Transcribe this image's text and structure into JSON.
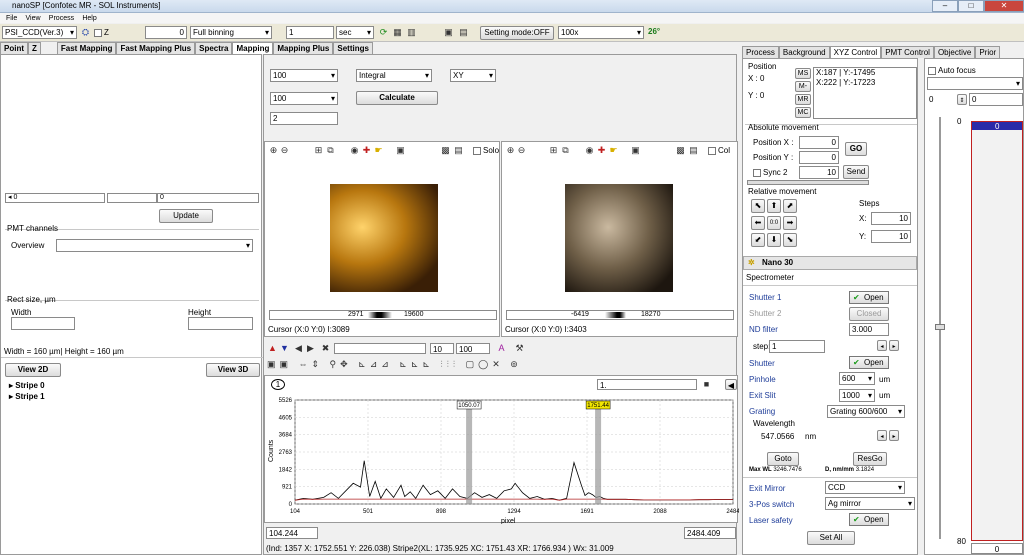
{
  "window": {
    "title": "nanoSP [Confotec MR - SOL Instruments]"
  },
  "menu": [
    "File",
    "View",
    "Process",
    "Help"
  ],
  "toolbar": {
    "device": "PSI_CCD(Ver.3)",
    "z_label": "Z",
    "value0": "0",
    "binning": "Full binning",
    "exposure": "1",
    "unit": "sec",
    "mode_button": "Setting mode:OFF",
    "objective": "100x",
    "temperature": "26°"
  },
  "left_tabs": [
    "Point",
    "Z",
    "Fast Mapping",
    "Fast Mapping Plus",
    "Spectra",
    "Mapping",
    "Mapping Plus",
    "Settings"
  ],
  "left": {
    "slider1_value": "0",
    "slider2_value": "0",
    "update_btn": "Update",
    "pmt_channels": "PMT channels",
    "overview": "Overview",
    "rect_size": "Rect size, µm",
    "width_lbl": "Width",
    "height_lbl": "Height",
    "size_text": "Width = 160 µm| Height = 160 µm",
    "view2d": "View 2D",
    "view3d": "View 3D",
    "tree": [
      "Stripe 0",
      "Stripe 1"
    ]
  },
  "center": {
    "c1": "100",
    "c2": "Integral",
    "c3": "XY",
    "c4": "100",
    "calculate": "Calculate",
    "f5": "2",
    "img1_solo": "Solo",
    "img2_col": "Col",
    "hist1_min": "2971",
    "hist1_max": "19600",
    "hist2_min": "-6419",
    "hist2_max": "18270",
    "cursor1": "Cursor (X:0 Y:0) I:3089",
    "cursor2": "Cursor (X:0 Y:0) I:3403",
    "spec_val1": "10",
    "spec_val2": "100",
    "circle_num": "1",
    "spec_field": "1.",
    "pos_left": "104.244",
    "pos_right": "2484.409",
    "status": "(Ind: 1357 X: 1752.551 Y: 226.038)  Stripe2(XL: 1735.925 XC: 1751.43 XR: 1766.934 )  Wx: 31.009"
  },
  "chart_data": {
    "type": "line",
    "ylabel": "Counts",
    "xlabel": "pixel",
    "yticks": [
      "5526",
      "4605",
      "3684",
      "2763",
      "1842",
      "921",
      "0"
    ],
    "xticks": [
      "104",
      "501",
      "898",
      "1294",
      "1691",
      "2088",
      "2484"
    ],
    "ylim": [
      0,
      5526
    ],
    "xlim": [
      104,
      2484
    ],
    "markers": [
      {
        "label": "1050.07",
        "x": 1050
      },
      {
        "label": "1751.44",
        "x": 1751
      }
    ],
    "series": [
      {
        "x": [
          104,
          150,
          200,
          260,
          300,
          340,
          380,
          420,
          460,
          480,
          510,
          540,
          570,
          600,
          640,
          680,
          700,
          730,
          760,
          800,
          840,
          880,
          920,
          960,
          1000,
          1040,
          1080,
          1120,
          1160,
          1200,
          1240,
          1280,
          1300,
          1340,
          1380,
          1420,
          1460,
          1500,
          1540,
          1580,
          1620,
          1660,
          1680,
          1700,
          1720,
          1740,
          1760,
          1780,
          1800,
          1850,
          1900,
          1950,
          2000,
          2050,
          2100,
          2150,
          2200,
          2250,
          2300,
          2350,
          2400,
          2450,
          2484
        ],
        "y": [
          200,
          300,
          250,
          350,
          600,
          300,
          700,
          1100,
          900,
          2300,
          400,
          1200,
          300,
          800,
          350,
          1000,
          400,
          650,
          300,
          1000,
          500,
          700,
          300,
          800,
          400,
          300,
          600,
          350,
          500,
          300,
          700,
          800,
          1100,
          600,
          300,
          400,
          250,
          300,
          200,
          300,
          2200,
          1000,
          450,
          600,
          500,
          350,
          400,
          300,
          250,
          250,
          250,
          230,
          220,
          220,
          220,
          220,
          220,
          220,
          230,
          230,
          240,
          240,
          240
        ]
      }
    ]
  },
  "right_tabs": [
    "Process",
    "Background",
    "XYZ Control",
    "PMT Control",
    "Objective",
    "Prior"
  ],
  "right": {
    "position": "Position",
    "x_lbl": "X : 0",
    "y_lbl": "Y : 0",
    "ms": "MS",
    "mminus": "M-",
    "mr": "MR",
    "mc": "MC",
    "pos_list": [
      "X:187 | Y:-17495",
      "X:222 | Y:-17223"
    ],
    "abs_movement": "Absolute movement",
    "posx_lbl": "Position X :",
    "posx_val": "0",
    "posy_lbl": "Position Y :",
    "posy_val": "0",
    "go": "GO",
    "sync": "Sync 2",
    "sync_val": "10",
    "send": "Send",
    "rel_movement": "Relative movement",
    "steps": "Steps",
    "stepx_lbl": "X:",
    "stepx_val": "10",
    "stepy_lbl": "Y:",
    "stepy_val": "10",
    "zero": "0:0",
    "nano": "Nano 30",
    "spectrometer": "Spectrometer",
    "shutter1": "Shutter 1",
    "open": "Open",
    "shutter2": "Shutter 2",
    "closed": "Closed",
    "nd_filter": "ND filter",
    "nd_val": "3.000",
    "step_lbl": "step:",
    "step_val": "1",
    "shutter": "Shutter",
    "pinhole": "Pinhole",
    "pinhole_val": "600",
    "um": "um",
    "exit_slit": "Exit Slit",
    "exit_slit_val": "1000",
    "grating": "Grating",
    "grating_val": "Grating 600/600",
    "wavelength": "Wavelength",
    "wavelength_val": "547.0566",
    "nm": "nm",
    "goto": "Goto",
    "resgo": "ResGo",
    "maxwl": "Max WL",
    "maxwl_val": "3246.7476",
    "dnm": "D, nm/mm",
    "dnm_val": "3.1824",
    "exit_mirror": "Exit Mirror",
    "exit_mirror_val": "CCD",
    "pos3": "3-Pos switch",
    "pos3_val": "Ag mirror",
    "laser": "Laser safety",
    "setall": "Set All"
  },
  "far_right": {
    "autofocus": "Auto focus",
    "v1": "0",
    "v2": "0",
    "scale_top": "0",
    "scale_bottom": "80",
    "bottom_field": "0",
    "top_field": "0"
  }
}
